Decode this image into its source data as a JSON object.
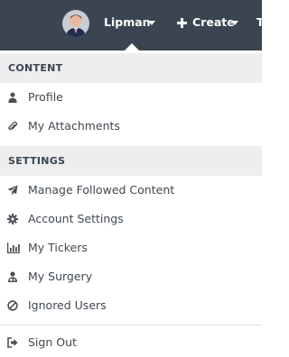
{
  "header": {
    "user_name": "Lipman",
    "create_label": "Create",
    "icons": {
      "avatar": "user-avatar",
      "user_caret": "caret-down-icon",
      "create": "plus-icon",
      "create_caret": "caret-down-icon"
    }
  },
  "menu": {
    "sections": [
      {
        "title": "CONTENT",
        "items": [
          {
            "label": "Profile",
            "icon": "user-icon"
          },
          {
            "label": "My Attachments",
            "icon": "paperclip-icon"
          }
        ]
      },
      {
        "title": "SETTINGS",
        "items": [
          {
            "label": "Manage Followed Content",
            "icon": "paper-plane-icon"
          },
          {
            "label": "Account Settings",
            "icon": "gear-icon"
          },
          {
            "label": "My Tickers",
            "icon": "bar-chart-icon"
          },
          {
            "label": "My Surgery",
            "icon": "doctor-icon"
          },
          {
            "label": "Ignored Users",
            "icon": "ban-icon"
          }
        ]
      }
    ],
    "sign_out": {
      "label": "Sign Out",
      "icon": "sign-out-icon"
    }
  },
  "colors": {
    "topbar": "#3a4551",
    "section_bg": "#eeeeee",
    "text": "#404850",
    "icon": "#4a4f55"
  }
}
